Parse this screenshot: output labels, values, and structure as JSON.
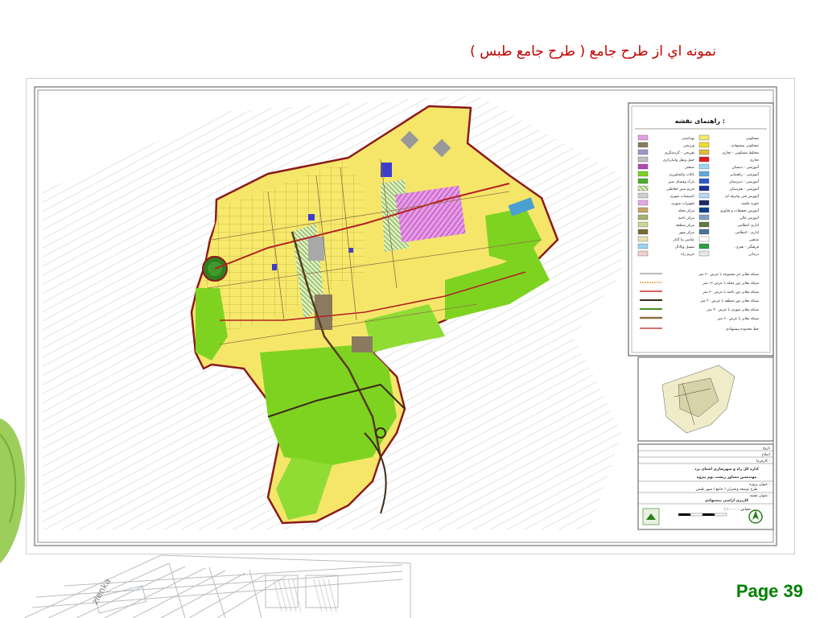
{
  "slide": {
    "title": "نمونه اي از طرح جامع ( طرح جامع طبس )",
    "page_label": "Page 39"
  },
  "colors": {
    "title": "#c00000",
    "page_label": "#008000",
    "residential": "#f5e66a",
    "green_space": "#7ed321",
    "dense_yellow": "#e7d420",
    "sport": "#cc66cc",
    "water_blue": "#3d3dcc",
    "road_red": "#b22222",
    "boundary": "#8b1a1a"
  },
  "legend": {
    "title": "راهنمای نقشه :",
    "left_items": [
      "بهداشتی",
      "ورزشی",
      "تفریحی - گردشگری",
      "حمل ونقل وانبارداری",
      "صنعتی",
      "باغات وکشاورزی",
      "پارک وفضای سبز",
      "حریم سبز حفاظتی",
      "تاسیسات شهری",
      "تجهیزات شهری",
      "مرکز محله",
      "مرکز ناحیه",
      "مرکز منطقه",
      "مرکز شهر",
      "عناصر بنا گذار",
      "مسیل وکانال",
      "حریم راه"
    ],
    "right_items": [
      "مسکونی",
      "مسکونی پیشنهادی",
      "مختلط مسکونی - تجاری",
      "تجاری",
      "آموزشی - دبستان",
      "آموزشی - راهنمایی",
      "آموزشی - دبیرستان",
      "آموزشی - هنرستان",
      "آموزش فنی وحرفه ای",
      "حوزه علمیه",
      "آموزش تحقیقات و فناوری",
      "آموزش عالی",
      "اداری انتظامی",
      "اداری - انتظامی",
      "مذهبی",
      "فرهنگی - هنری",
      "درمانی"
    ],
    "road_items": [
      "شبکه معابر جز مجموعه با عرض ۲۰ متر",
      "شبکه معابر دور محله با عرض ۱۶ متر",
      "شبکه معابر دور ناحیه با عرض ۲۰ متر",
      "شبکه معابر دور منطقه با عرض ۳۰ متر",
      "شبکه معابر شهری با عرض ۴۰ متر",
      "شبکه معابر با عرض ۶۰ متر",
      "خط محدوده پیشنهادی"
    ],
    "title_block": [
      "تاریخ",
      "اصلاح",
      "کارفرما :",
      "اداره کل راه و شهرسازی استان یزد",
      "مهندسین مشاور زیست بوم پیژوه",
      "عنوان پروژه :",
      "طرح توسعه وعمران ( جامع ) شهر طبس",
      "عنوان نقشه :",
      "کاربری اراضی پیشنهادی",
      "مقیاس : ۱:۱۰۰۰۰"
    ]
  }
}
